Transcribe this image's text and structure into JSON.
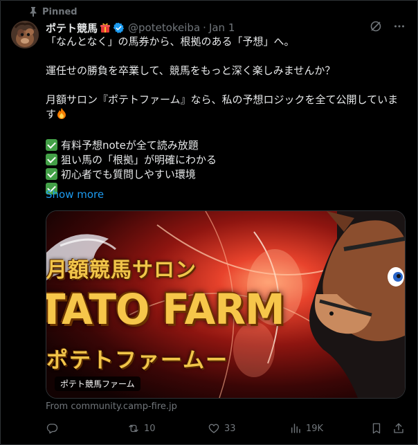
{
  "pinned": {
    "label": "Pinned"
  },
  "author": {
    "name": "ポテト競馬",
    "handle": "@potetokeiba",
    "separator": "·",
    "date": "Jan 1"
  },
  "tweet": {
    "lines": [
      "「なんとなく」の馬券から、根拠のある「予想」へ。",
      "運任せの勝負を卒業して、競馬をもっと深く楽しみませんか？",
      "月額サロン『ポテトファーム』なら、私の予想ロジックを全て公開していま",
      "す"
    ],
    "checklist": [
      "有料予想noteが全て読み放題",
      "狙い馬の「根拠」が明確にわかる",
      "初心者でも質問しやすい環境",
      ""
    ],
    "show_more": "Show more"
  },
  "card": {
    "banner_line1": "月額競馬サロン",
    "banner_line2": "TATO FARM",
    "banner_line3": "ポテトファームー",
    "label": "ポテト競馬ファーム",
    "source": "From community.camp-fire.jp"
  },
  "actions": {
    "replies": "",
    "reposts": "10",
    "likes": "33",
    "views": "19K"
  },
  "colors": {
    "background": "#000000",
    "text": "#e7e9ea",
    "muted": "#71767b",
    "link": "#1d9bf0",
    "verified": "#1d9bf0"
  },
  "icons": [
    "pin-icon",
    "verified-badge-icon",
    "grok-icon",
    "more-icon",
    "reply-icon",
    "repost-icon",
    "like-icon",
    "views-icon",
    "bookmark-icon",
    "share-icon"
  ]
}
